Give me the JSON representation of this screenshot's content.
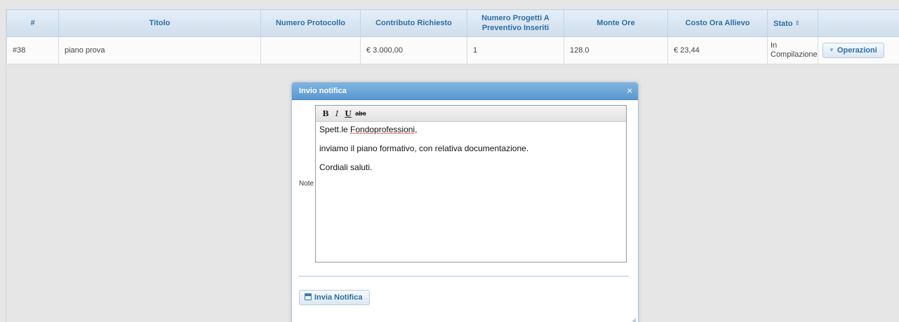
{
  "table": {
    "headers": {
      "num": "#",
      "titolo": "Titolo",
      "protocollo": "Numero Protocollo",
      "contributo": "Contributo Richiesto",
      "progetti": "Numero Progetti A Preventivo Inseriti",
      "monte_ore": "Monte Ore",
      "costo": "Costo Ora Allievo",
      "stato": "Stato"
    },
    "sort_icon": "sort-updown-icon",
    "rows": [
      {
        "num": "#38",
        "titolo": "piano prova",
        "protocollo": "",
        "contributo": "€ 3.000,00",
        "progetti": "1",
        "monte_ore": "128.0",
        "costo": "€ 23,44",
        "stato": "In Compilazione",
        "ops_label": "Operazioni"
      }
    ]
  },
  "dialog": {
    "title": "Invio notifica",
    "close_glyph": "×",
    "note_label": "Note",
    "toolbar": {
      "bold": "B",
      "italic": "I",
      "underline": "U",
      "strike": "abc"
    },
    "editor": {
      "line1_prefix": "Spett.le ",
      "line1_name": "Fondoprofessioni",
      "line1_suffix": ",",
      "line2": "inviamo il piano formativo, con relativa documentazione.",
      "line3": "Cordiali saluti."
    },
    "send_label": "Invia Notifica"
  },
  "colors": {
    "header_text": "#2e6ea5",
    "titlebar": "#5a98cf",
    "background": "#e6e6e6"
  }
}
